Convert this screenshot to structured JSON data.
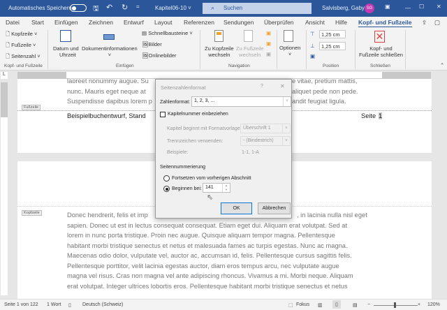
{
  "titlebar": {
    "autosave": "Automatisches Speichern",
    "doc": "Kapitel06-10 ˅",
    "search": "Suchen",
    "user": "Salvisberg, Gaby",
    "initials": "SG"
  },
  "menu": [
    "Datei",
    "Start",
    "Einfügen",
    "Zeichnen",
    "Entwurf",
    "Layout",
    "Referenzen",
    "Sendungen",
    "Überprüfen",
    "Ansicht",
    "Hilfe",
    "Kopf- und Fußzeile"
  ],
  "ribbon": {
    "kopfzeile": "Kopfzeile ˅",
    "fusszeile": "Fußzeile ˅",
    "seitenzahl": "Seitenzahl ˅",
    "group1": "Kopf- und Fußzeile",
    "datum1": "Datum und",
    "datum2": "Uhrzeit",
    "dokinfo": "Dokumentinformationen",
    "dokinfo2": "˅",
    "schnell": "Schnellbausteine ˅",
    "bilder": "Bilder",
    "online": "Onlinebilder",
    "group2": "Einfügen",
    "zukopf1": "Zu Kopfzeile",
    "zukopf2": "wechseln",
    "zufuss1": "Zu Fußzeile",
    "zufuss2": "wechseln",
    "group3": "Navigation",
    "optionen": "Optionen",
    "optionen2": "˅",
    "pos1": "1,25 cm",
    "pos2": "1,25 cm",
    "group5": "Position",
    "close1": "Kopf- und",
    "close2": "Fußzeile schließen",
    "group6": "Schließen"
  },
  "page1": {
    "lines": [
      [
        "laoreet nonummy augue. Su",
        "e vitae, pretium mattis,"
      ],
      [
        "nunc. Mauris eget neque at",
        "aliquet pede non pede."
      ],
      [
        "Suspendisse dapibus lorem p",
        "andit feugiat ligula."
      ]
    ],
    "footer_label": "Fußzeile",
    "footer_left": "Beispielbuchentwurf, Stand",
    "footer_right": "Seite",
    "footer_num": "1"
  },
  "page2": {
    "header_label": "Kopfzeile",
    "first_left": "Donec hendrerit, felis et imp",
    "first_right": ", in lacinia nulla nisl eget",
    "lines": [
      "sapien. Donec ut est in lectus consequat consequat. Etiam eget dui. Aliquam erat volutpat. Sed at",
      "lorem in nunc porta tristique. Proin nec augue. Quisque aliquam tempor magna. Pellentesque",
      "habitant morbi tristique senectus et netus et malesuada fames ac turpis egestas. Nunc ac magna.",
      "Maecenas odio dolor, vulputate vel, auctor ac, accumsan id, felis. Pellentesque cursus sagittis felis.",
      "Pellentesque porttitor, velit lacinia egestas auctor, diam eros tempus arcu, nec vulputate augue",
      "magna vel risus. Cras non magna vel ante adipiscing rhoncus. Vivamus a mi. Morbi neque. Aliquam",
      "erat volutpat. Integer ultrices lobortis eros. Pellentesque habitant morbi tristique senectus et netus"
    ]
  },
  "dialog": {
    "title": "Seitenzahlenformat",
    "help": "?",
    "close": "✕",
    "zahlenformat_label": "Zahlenformat:",
    "zahlenformat_value": "1, 2, 3, ...",
    "kapitel_check": "Kapitelnummer einbeziehen",
    "kapitel_label": "Kapitel beginnt mit Formatvorlage:",
    "kapitel_value": "Überschrift 1",
    "trenn_label": "Trennzeichen verwenden:",
    "trenn_value": "-     (Bindestrich)",
    "beispiele_label": "Beispiele:",
    "beispiele_value": "1-1, 1-A",
    "section": "Seitennummerierung",
    "radio1": "Fortsetzen vom vorherigen Abschnitt",
    "radio2": "Beginnen bei:",
    "start_value": "141",
    "radio_selected": "Beginnen bei:",
    "kapitel_checked": false,
    "ok": "OK",
    "cancel": "Abbrechen"
  },
  "status": {
    "page": "Seite 1 von 122",
    "words": "1 Wort",
    "lang": "Deutsch (Schweiz)",
    "focus": "Fokus",
    "zoom": "120%",
    "zoom_level_percent": 120
  },
  "colors": {
    "accent": "#2b579a",
    "avatar": "#c239b3"
  }
}
